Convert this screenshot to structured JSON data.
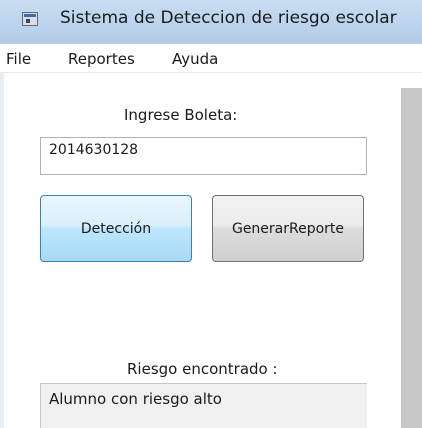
{
  "window": {
    "title": "Sistema de Deteccion de riesgo escolar"
  },
  "menu": {
    "items": [
      "File",
      "Reportes",
      "Ayuda"
    ]
  },
  "form": {
    "boleta_label": "Ingrese Boleta:",
    "boleta_value": "2014630128",
    "deteccion_button": "Detección",
    "generar_button": "GenerarReporte",
    "riesgo_label": "Riesgo encontrado :",
    "riesgo_result": "Alumno con riesgo alto"
  }
}
